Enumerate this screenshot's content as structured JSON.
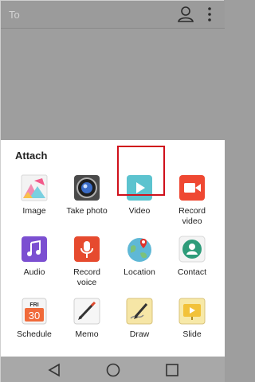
{
  "header": {
    "to_label": "To"
  },
  "sheet": {
    "title": "Attach",
    "items": [
      {
        "label": "Image",
        "icon": "image-icon"
      },
      {
        "label": "Take photo",
        "icon": "camera-icon"
      },
      {
        "label": "Video",
        "icon": "play-icon"
      },
      {
        "label": "Record video",
        "icon": "video-camera-icon"
      },
      {
        "label": "Audio",
        "icon": "music-note-icon"
      },
      {
        "label": "Record voice",
        "icon": "microphone-icon"
      },
      {
        "label": "Location",
        "icon": "globe-pin-icon"
      },
      {
        "label": "Contact",
        "icon": "contact-icon"
      },
      {
        "label": "Schedule",
        "icon": "calendar-icon",
        "day": "FRI",
        "date": "30"
      },
      {
        "label": "Memo",
        "icon": "memo-icon"
      },
      {
        "label": "Draw",
        "icon": "draw-icon"
      },
      {
        "label": "Slide",
        "icon": "slide-icon"
      }
    ]
  },
  "colors": {
    "highlight": "#d0101b",
    "video": "#5cc3cf",
    "record_video": "#ef4832",
    "audio": "#7b4fd1",
    "record_voice": "#e64a2e"
  }
}
